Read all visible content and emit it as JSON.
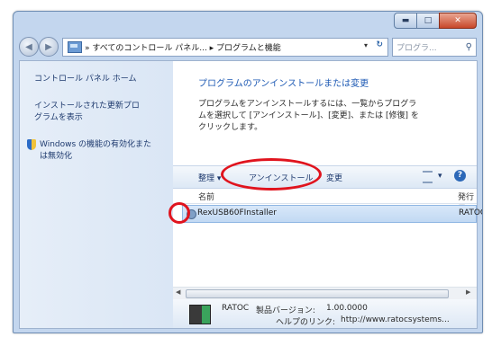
{
  "window": {
    "caption_buttons": {
      "minimize_glyph": "▬",
      "maximize_glyph": "□",
      "close_glyph": "✕"
    }
  },
  "navigation": {
    "back_glyph": "◀",
    "forward_glyph": "▶",
    "address_path": "» すべてのコントロール パネル... ▸ プログラムと機能",
    "dropdown_glyph": "▾",
    "refresh_glyph": "↻",
    "search_placeholder": "プログラ...",
    "search_glyph": "⚲"
  },
  "left_pane": {
    "control_panel_home": "コントロール パネル ホーム",
    "installed_updates": [
      "インストールされた更新プロ",
      "グラムを表示"
    ],
    "windows_features": [
      "Windows の機能の有効化また",
      "は無効化"
    ]
  },
  "main": {
    "title": "プログラムのアンインストールまたは変更",
    "description": [
      "プログラムをアンインストールするには、一覧からプログラ",
      "ムを選択して [アンインストール]、[変更]、または [修復] を",
      "クリックします。"
    ]
  },
  "toolbar": {
    "organize": "整理 ▾",
    "uninstall": "アンインストール",
    "change": "変更",
    "view_drop": "▾",
    "help": "?"
  },
  "list": {
    "columns": {
      "name": "名前",
      "publisher": "発行元"
    },
    "rows": [
      {
        "name": "RexUSB60FInstaller",
        "publisher": "RATOC"
      }
    ]
  },
  "scrollbar": {
    "left_glyph": "◀",
    "right_glyph": "▶"
  },
  "details": {
    "publisher": "RATOC",
    "version_label": "製品バージョン:",
    "version": "1.00.0000",
    "help_label": "ヘルプのリンク:",
    "help_link": "http://www.ratocsystems..."
  },
  "colors": {
    "highlight": "#e0141e",
    "link": "#1e5ab4"
  }
}
